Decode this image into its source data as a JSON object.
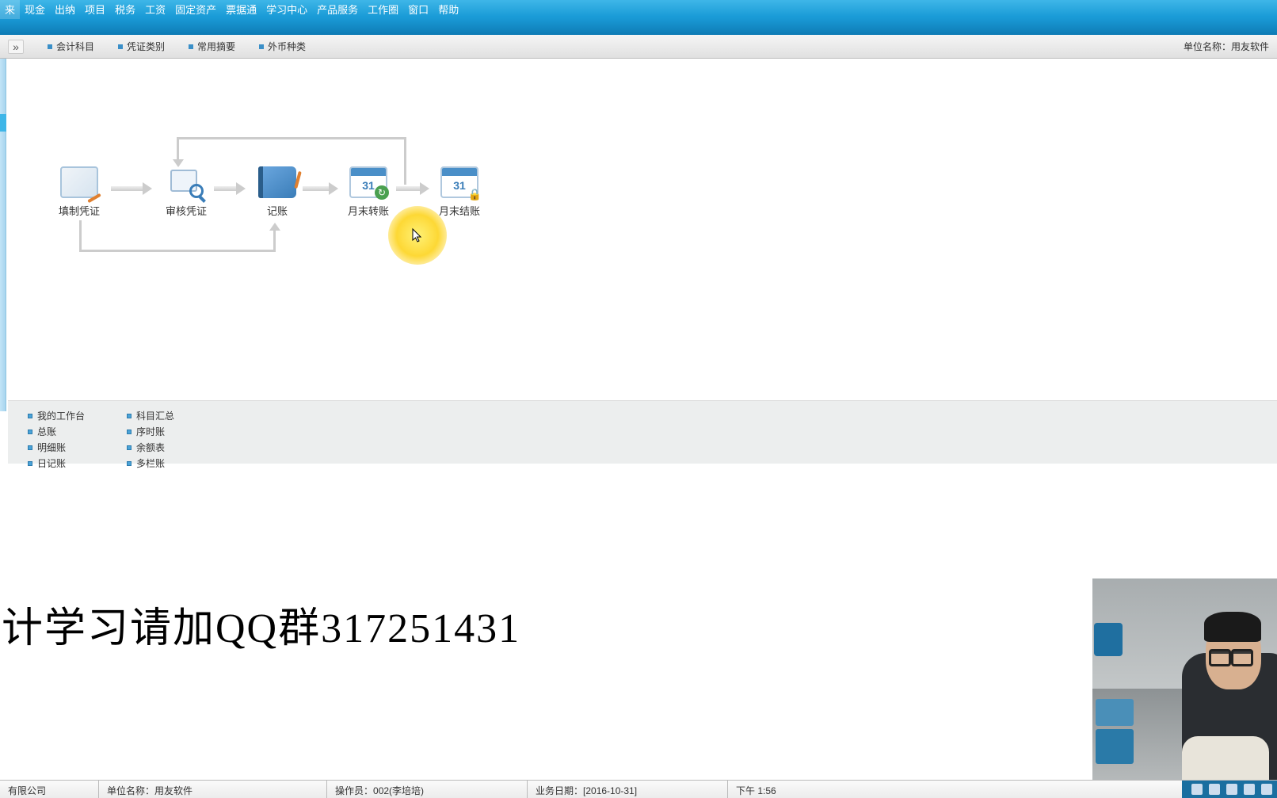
{
  "menu": {
    "items": [
      "来",
      "现金",
      "出纳",
      "项目",
      "税务",
      "工资",
      "固定资产",
      "票据通",
      "学习中心",
      "产品服务",
      "工作圈",
      "窗口",
      "帮助"
    ]
  },
  "toolbar": {
    "collapse": "»",
    "items": [
      "会计科目",
      "凭证类别",
      "常用摘要",
      "外币种类"
    ],
    "right": "单位名称：用友软件"
  },
  "flow": {
    "nodes": [
      "填制凭证",
      "审核凭证",
      "记账",
      "月末转账",
      "月末结账"
    ],
    "calnum": "31"
  },
  "links": {
    "col1": [
      "我的工作台",
      "总账",
      "明细账",
      "日记账"
    ],
    "col2": [
      "科目汇总",
      "序时账",
      "余额表",
      "多栏账"
    ]
  },
  "overlay": "计学习请加QQ群317251431",
  "status": {
    "c0": "有限公司",
    "c1_label": "单位名称：",
    "c1_value": "用友软件",
    "c2_label": "操作员：",
    "c2_value": "002(李培培)",
    "c3_label": "业务日期：",
    "c3_value": "[2016-10-31]",
    "c4": "下午 1:56"
  }
}
